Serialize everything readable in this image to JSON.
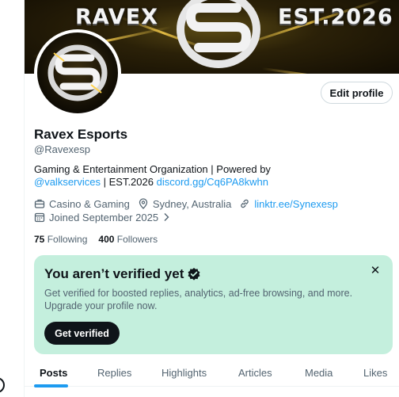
{
  "banner": {
    "left_text": "RAVEX",
    "right_text": "EST.2026",
    "accent_color": "#ffd34d"
  },
  "profile": {
    "name": "Ravex Esports",
    "handle": "@Ravexesp",
    "edit_label": "Edit profile",
    "bio_line1": "Gaming & Entertainment Organization | Powered by",
    "bio_mention": "@valkservices",
    "bio_sep": " | EST.2026 ",
    "bio_link": "discord.gg/Cq6PA8kwhn",
    "category": "Casino & Gaming",
    "location": "Sydney, Australia",
    "website": "linktr.ee/Synexesp",
    "joined": "Joined September 2025",
    "following_count": "75",
    "following_label": "Following",
    "followers_count": "400",
    "followers_label": "Followers"
  },
  "verify_card": {
    "title": "You aren’t verified yet",
    "description": "Get verified for boosted replies, analytics, ad-free browsing, and more. Upgrade your profile now.",
    "button_label": "Get verified",
    "background_color": "#c4efdd"
  },
  "tabs": [
    {
      "label": "Posts"
    },
    {
      "label": "Replies"
    },
    {
      "label": "Highlights"
    },
    {
      "label": "Articles"
    },
    {
      "label": "Media"
    },
    {
      "label": "Likes"
    }
  ],
  "colors": {
    "link": "#1d9bf0",
    "text": "#0f1419",
    "secondary": "#536471"
  }
}
